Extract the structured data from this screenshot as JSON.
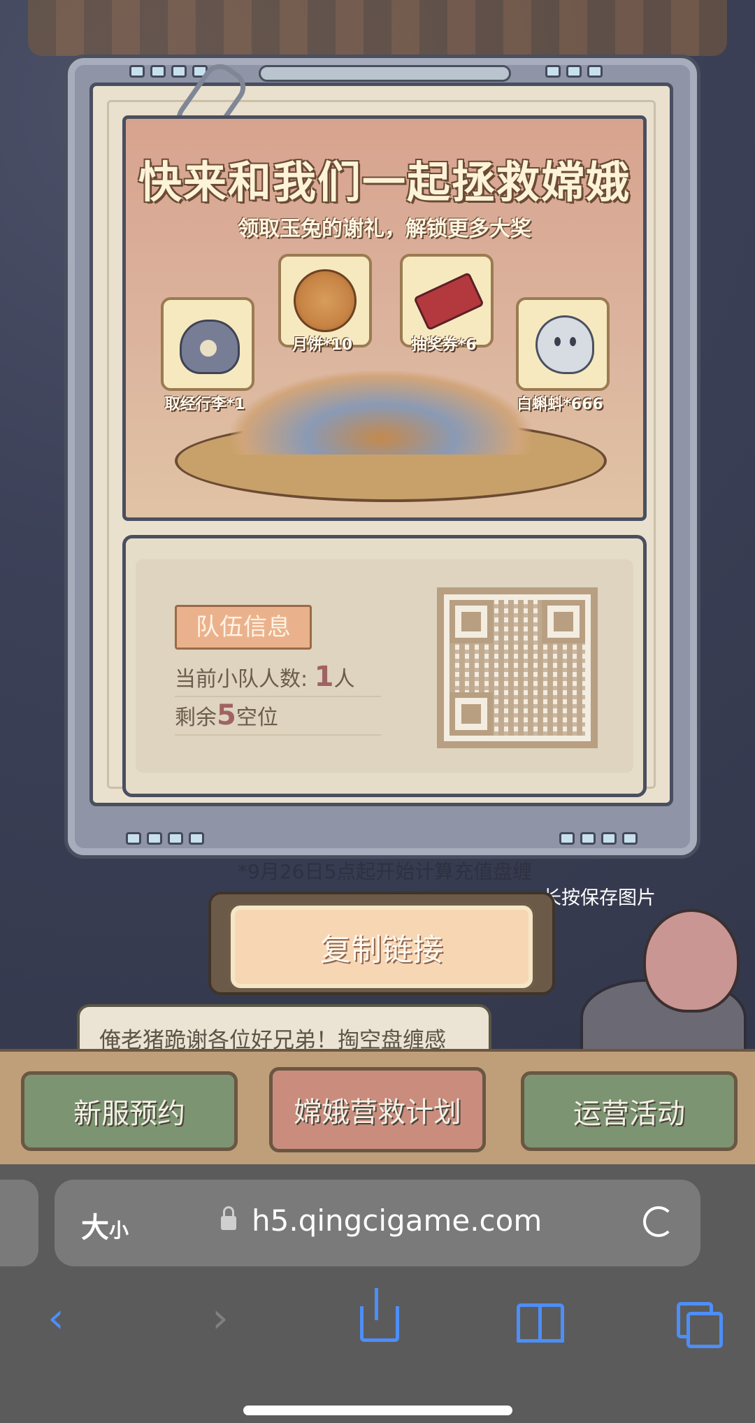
{
  "banner": {
    "title": "快来和我们一起拯救嫦娥",
    "subtitle": "领取玉兔的谢礼，解锁更多大奖",
    "rewards": [
      {
        "label": "取经行李*1",
        "icon": "bag-icon"
      },
      {
        "label": "月饼*10",
        "icon": "mooncake-icon"
      },
      {
        "label": "抽奖券*6",
        "icon": "ticket-icon"
      },
      {
        "label": "白蝌蚪*666",
        "icon": "ghost-icon"
      }
    ]
  },
  "team": {
    "tag": "队伍信息",
    "current_prefix": "当前小队人数:",
    "current_count": "1",
    "current_suffix": "人",
    "remaining_prefix": "剩余",
    "remaining_count": "5",
    "remaining_suffix": "空位"
  },
  "note": "*9月26日5点起开始计算充值盘缠",
  "save_hint": "长按保存图片",
  "copy_button": "复制链接",
  "bubble_text": "俺老猪跪谢各位好兄弟！掏空盘缠感",
  "nav": [
    "新服预约",
    "嫦娥营救计划",
    "运营活动"
  ],
  "browser": {
    "text_size": "大",
    "text_size_small": "小",
    "url": "h5.qingcigame.com"
  }
}
